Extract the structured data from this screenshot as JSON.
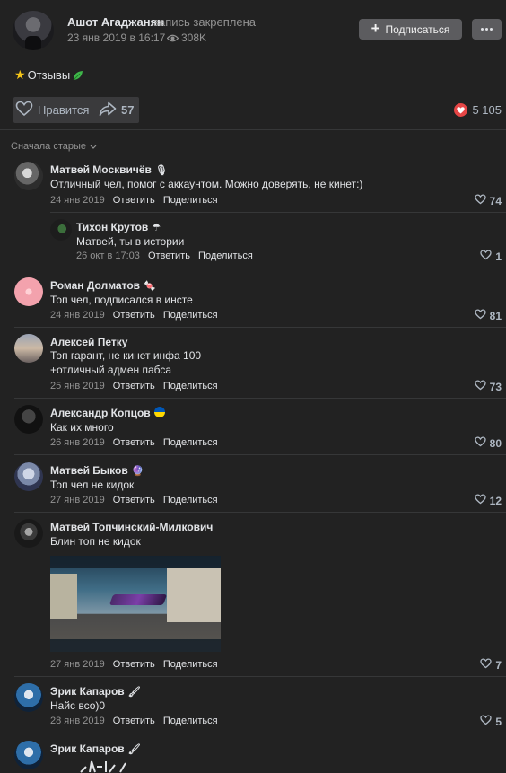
{
  "post": {
    "author": "Ашот Агаджанян",
    "note": "запись закреплена",
    "date": "23 янв 2019 в 16:17",
    "views": "308K",
    "subscribe_label": "Подписаться",
    "text": "Отзывы",
    "like_label": "Нравится",
    "shares": "57",
    "reactions_count": "5 105"
  },
  "sort_label": "Сначала старые",
  "actions": {
    "reply": "Ответить",
    "share": "Поделиться"
  },
  "comments": [
    {
      "name": "Матвей Москвичёв",
      "badge": "microphone-icon",
      "text": "Отличный чел, помог с аккаунтом. Можно доверять, не кинет:)",
      "date": "24 янв 2019",
      "likes": "74"
    },
    {
      "name": "Тихон Крутов",
      "badge": "umbrella-icon",
      "text": "Матвей, ты в истории",
      "date": "26 окт в 17:03",
      "likes": "1"
    },
    {
      "name": "Роман Долматов",
      "badge": "candy-icon",
      "text": "Топ чел, подписался в инсте",
      "date": "24 янв 2019",
      "likes": "81"
    },
    {
      "name": "Алексей Петку",
      "text_line1": "Топ гарант, не кинет инфа 100",
      "text_line2": "+отличный адмен пабса",
      "date": "25 янв 2019",
      "likes": "73"
    },
    {
      "name": "Александр Копцов",
      "badge": "ukraine-flag-icon",
      "text": "Как их много",
      "date": "26 янв 2019",
      "likes": "80"
    },
    {
      "name": "Матвей Быков",
      "badge": "crystal-ball-icon",
      "text": "Топ чел не кидок",
      "date": "27 янв 2019",
      "likes": "12"
    },
    {
      "name": "Матвей Топчинский-Милкович",
      "text": "Блин топ не кидок",
      "date": "27 янв 2019",
      "likes": "7"
    },
    {
      "name": "Эрик Капаров",
      "badge": "paintbrush-icon",
      "text": "Найс всо)0",
      "date": "28 янв 2019",
      "likes": "5"
    },
    {
      "name": "Эрик Капаров",
      "badge": "paintbrush-icon"
    }
  ]
}
